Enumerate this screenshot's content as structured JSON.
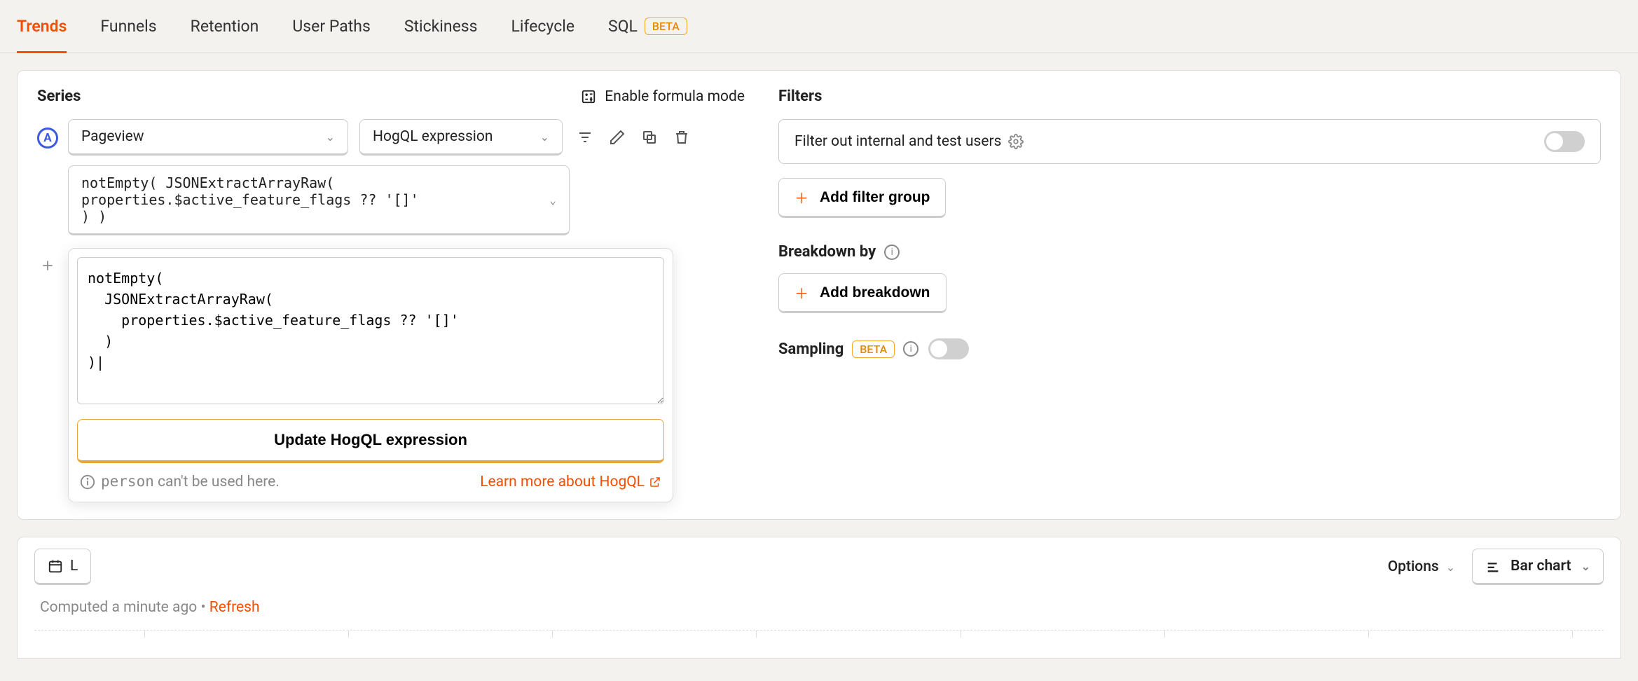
{
  "tabs": {
    "trends": "Trends",
    "funnels": "Funnels",
    "retention": "Retention",
    "user_paths": "User Paths",
    "stickiness": "Stickiness",
    "lifecycle": "Lifecycle",
    "sql": "SQL",
    "beta_badge": "BETA"
  },
  "series": {
    "title": "Series",
    "formula_toggle": "Enable formula mode",
    "letter": "A",
    "event_select": "Pageview",
    "math_select": "HogQL expression",
    "hogql_preview": "notEmpty( JSONExtractArrayRaw(\nproperties.$active_feature_flags ?? '[]'\n) )",
    "editor_value": "notEmpty(\n  JSONExtractArrayRaw(\n    properties.$active_feature_flags ?? '[]'\n  )\n)|",
    "update_button": "Update HogQL expression",
    "footer_warning_code": "person",
    "footer_warning_text": " can't be used here.",
    "learn_more": "Learn more about HogQL"
  },
  "filters": {
    "title": "Filters",
    "internal_users": "Filter out internal and test users",
    "add_filter_group": "Add filter group",
    "breakdown_title": "Breakdown by",
    "add_breakdown": "Add breakdown",
    "sampling_title": "Sampling",
    "sampling_badge": "BETA"
  },
  "toolbar": {
    "date_range_partial": "L",
    "options": "Options",
    "chart_type": "Bar chart"
  },
  "footer": {
    "computed": "Computed a minute ago",
    "separator": " • ",
    "refresh": "Refresh"
  }
}
